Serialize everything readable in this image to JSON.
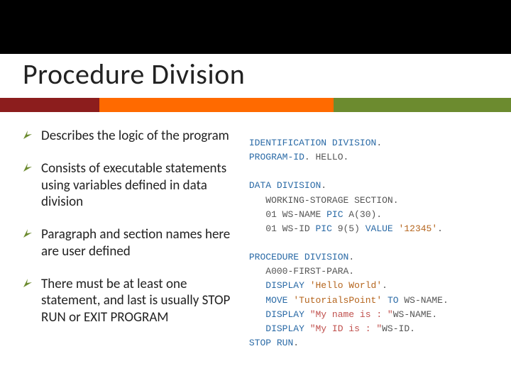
{
  "title": "Procedure Division",
  "bullets": [
    "Describes the logic of the program",
    "Consists of executable statements using variables defined in data division",
    "Paragraph and section names here are user defined",
    "There must be at least one statement, and last is usually STOP RUN or EXIT PROGRAM"
  ],
  "code": {
    "l1a": "IDENTIFICATION DIVISION",
    "l1b": ".",
    "l2a": "PROGRAM-ID",
    "l2b": ". HELLO.",
    "l3a": "DATA DIVISION",
    "l3b": ".",
    "l4": "   WORKING-STORAGE SECTION.",
    "l5a": "   01 WS-NAME ",
    "l5b": "PIC",
    "l5c": " A(30).",
    "l6a": "   01 WS-ID ",
    "l6b": "PIC",
    "l6c": " 9(5) ",
    "l6d": "VALUE",
    "l6e": " ",
    "l6f": "'12345'",
    "l6g": ".",
    "l7a": "PROCEDURE DIVISION",
    "l7b": ".",
    "l8": "   A000-FIRST-PARA.",
    "l9a": "   ",
    "l9b": "DISPLAY",
    "l9c": " ",
    "l9d": "'Hello World'",
    "l9e": ".",
    "l10a": "   ",
    "l10b": "MOVE",
    "l10c": " ",
    "l10d": "'TutorialsPoint'",
    "l10e": " ",
    "l10f": "TO",
    "l10g": " WS-NAME.",
    "l11a": "   ",
    "l11b": "DISPLAY",
    "l11c": " ",
    "l11d": "\"My name is : \"",
    "l11e": "WS-NAME.",
    "l12a": "   ",
    "l12b": "DISPLAY",
    "l12c": " ",
    "l12d": "\"My ID is : \"",
    "l12e": "WS-ID.",
    "l13a": "STOP RUN",
    "l13b": "."
  }
}
